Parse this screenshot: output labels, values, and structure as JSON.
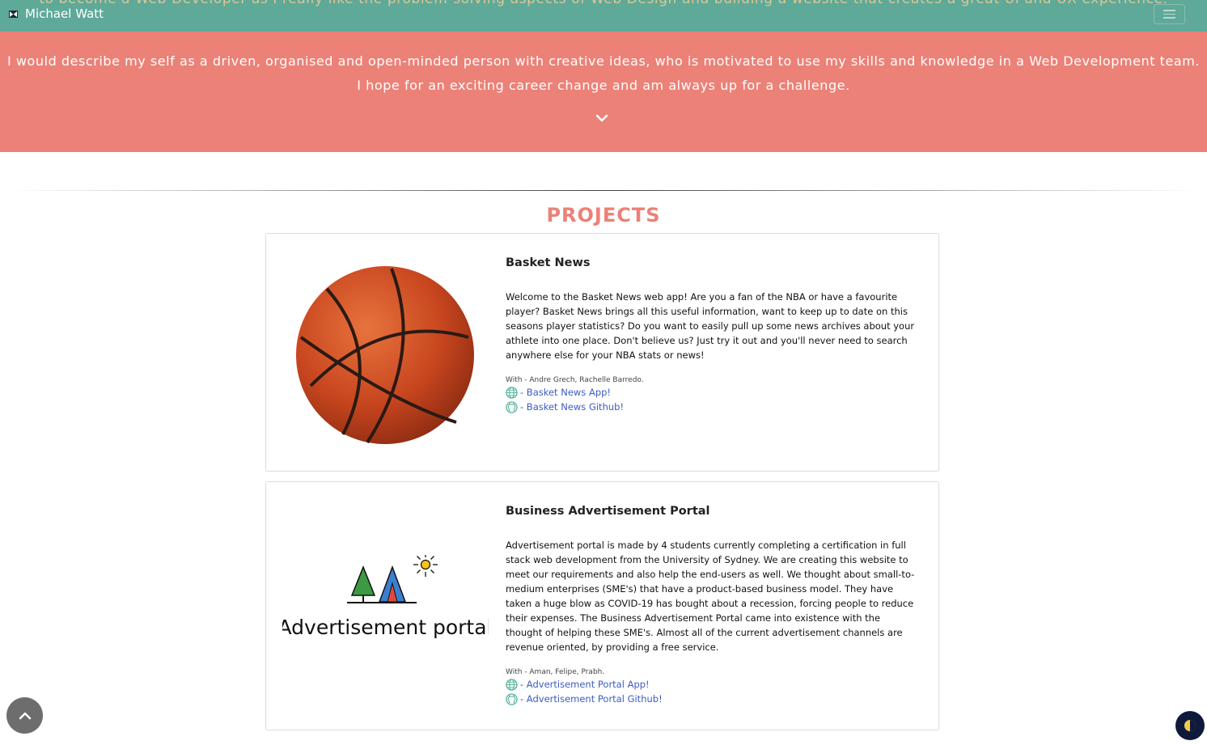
{
  "navbar": {
    "brand": "Michael Watt",
    "scrolled_text": "to become a Web Developer as I really like the problem-solving aspects of Web Design and building a website that creates a great UI and UX experience."
  },
  "hero": {
    "line1": "I would describe my self as a driven, organised and open-minded person with creative ideas, who is motivated to use my skills and knowledge in a Web Development team.",
    "line2": "I hope for an exciting career change and am always up for a challenge."
  },
  "projects": {
    "title": "PROJECTS",
    "items": [
      {
        "title": "Basket News",
        "description": "Welcome to the Basket News web app! Are you a fan of the NBA or have a favourite player? Basket News brings all this useful information, want to keep up to date on this seasons player statistics? Do you want to easily pull up some news archives about your athlete into one place. Don't believe us? Just try it out and you'll never need to search anywhere else for your NBA stats or news!",
        "with": "With - Andre Grech, Rachelle Barredo.",
        "app_link": "- Basket News App!",
        "github_link": "- Basket News Github!"
      },
      {
        "title": "Business Advertisement Portal",
        "description": "Advertisement portal is made by 4 students currently completing a certification in full stack web development from the University of Sydney. We are creating this website to meet our requirements and also help the end-users as well. We thought about small-to-medium enterprises (SME's) that have a product-based business model. They have taken a huge blow as COVID-19 has bought about a recession, forcing people to reduce their expenses. The Business Advertisement Portal came into existence with the thought of helping these SME's. Almost all of the current advertisement channels are revenue oriented, by providing a free service.",
        "with": "With - Aman, Felipe, Prabh.",
        "app_link": "- Advertisement Portal App!",
        "github_link": "- Advertisement Portal Github!",
        "logo_text": "Advertisement portal"
      }
    ]
  },
  "colors": {
    "navbar": "#5fa999",
    "hero": "#ec8177",
    "accent_title": "#ec8177",
    "link": "#3d5cc4",
    "icon": "#5fb8a2"
  },
  "icons": {
    "brand": "logo-icon",
    "menu": "hamburger-icon",
    "scroll": "chevron-down-icon",
    "app": "globe-icon",
    "github": "github-icon",
    "back_to_top": "chevron-up-icon",
    "theme": "moon-icon"
  }
}
